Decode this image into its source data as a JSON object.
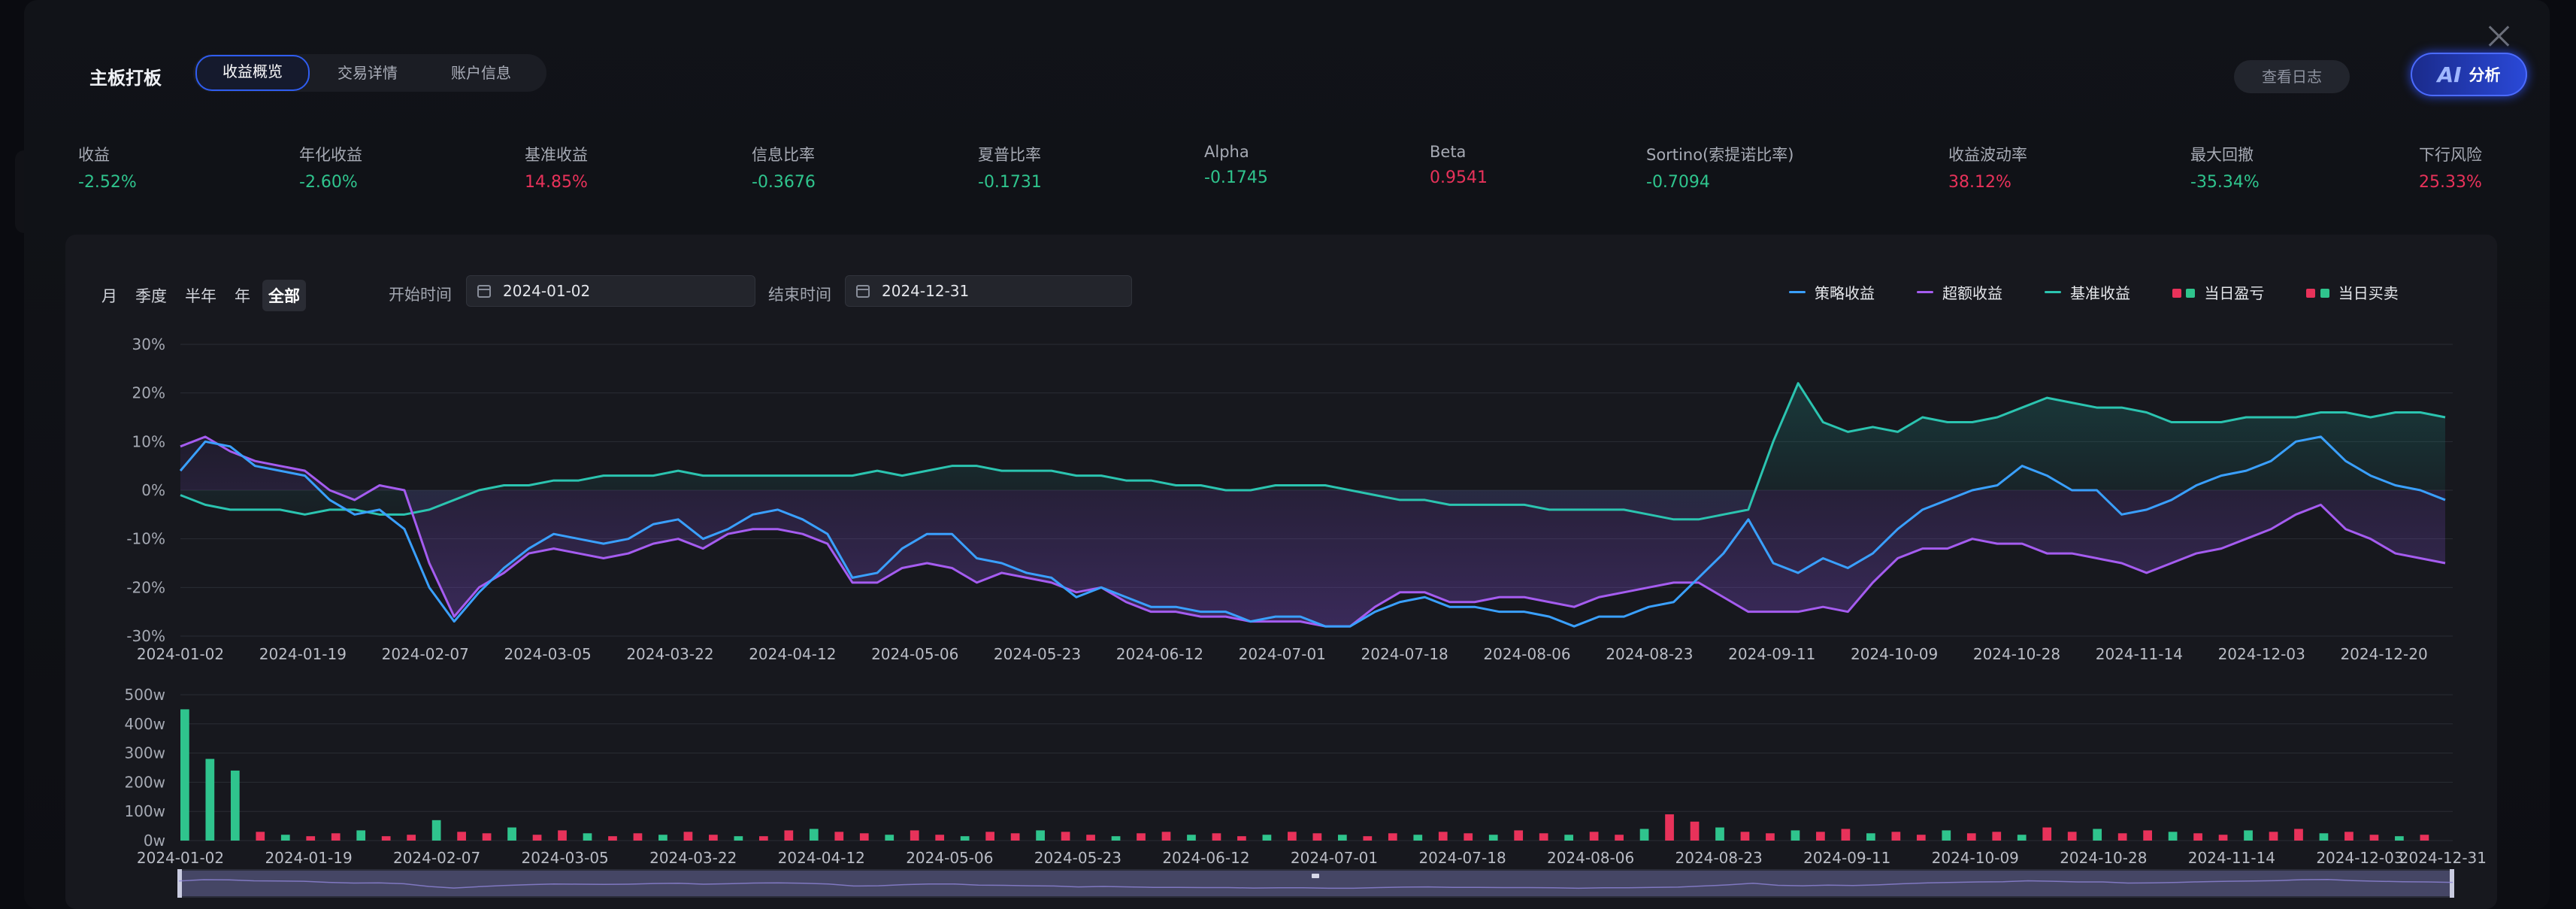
{
  "header": {
    "title": "主板打板",
    "tabs": [
      {
        "label": "收益概览",
        "active": true
      },
      {
        "label": "交易详情",
        "active": false
      },
      {
        "label": "账户信息",
        "active": false
      }
    ],
    "log_button": "查看日志",
    "ai_button": {
      "icon": "AI",
      "label": "分析"
    }
  },
  "metrics": [
    {
      "label": "收益",
      "value": "-2.52%",
      "tone": "neg"
    },
    {
      "label": "年化收益",
      "value": "-2.60%",
      "tone": "neg"
    },
    {
      "label": "基准收益",
      "value": "14.85%",
      "tone": "pos"
    },
    {
      "label": "信息比率",
      "value": "-0.3676",
      "tone": "neg"
    },
    {
      "label": "夏普比率",
      "value": "-0.1731",
      "tone": "neg"
    },
    {
      "label": "Alpha",
      "value": "-0.1745",
      "tone": "neg"
    },
    {
      "label": "Beta",
      "value": "0.9541",
      "tone": "pos"
    },
    {
      "label": "Sortino(索提诺比率)",
      "value": "-0.7094",
      "tone": "neg"
    },
    {
      "label": "收益波动率",
      "value": "38.12%",
      "tone": "pos"
    },
    {
      "label": "最大回撤",
      "value": "-35.34%",
      "tone": "neg"
    },
    {
      "label": "下行风险",
      "value": "25.33%",
      "tone": "pos"
    }
  ],
  "filters": {
    "periods": [
      {
        "label": "月",
        "active": false
      },
      {
        "label": "季度",
        "active": false
      },
      {
        "label": "半年",
        "active": false
      },
      {
        "label": "年",
        "active": false
      },
      {
        "label": "全部",
        "active": true
      }
    ],
    "start_label": "开始时间",
    "start_date": "2024-01-02",
    "end_label": "结束时间",
    "end_date": "2024-12-31"
  },
  "legend": [
    {
      "label": "策略收益",
      "kind": "line",
      "color": "#3aa0ff"
    },
    {
      "label": "超额收益",
      "kind": "line",
      "color": "#a55cf0"
    },
    {
      "label": "基准收益",
      "kind": "line",
      "color": "#2bc4b0"
    },
    {
      "label": "当日盈亏",
      "kind": "squares",
      "colors": [
        "#e8325a",
        "#2fc48d"
      ]
    },
    {
      "label": "当日买卖",
      "kind": "squares",
      "colors": [
        "#e8325a",
        "#2fc48d"
      ]
    }
  ],
  "colors": {
    "positive": "#e8325a",
    "negative": "#2fc48d",
    "strategy": "#3aa0ff",
    "excess": "#a55cf0",
    "benchmark": "#2bc4b0"
  },
  "chart_data": [
    {
      "type": "line",
      "x_ticks": [
        "2024-01-02",
        "2024-01-19",
        "2024-02-07",
        "2024-03-05",
        "2024-03-22",
        "2024-04-12",
        "2024-05-06",
        "2024-05-23",
        "2024-06-12",
        "2024-07-01",
        "2024-07-18",
        "2024-08-06",
        "2024-08-23",
        "2024-09-11",
        "2024-10-09",
        "2024-10-28",
        "2024-11-14",
        "2024-12-03",
        "2024-12-20"
      ],
      "y_ticks": [
        "30%",
        "20%",
        "10%",
        "0%",
        "-10%",
        "-20%",
        "-30%"
      ],
      "ylim": [
        -30,
        30
      ],
      "grid": true,
      "series": [
        {
          "name": "策略收益",
          "values": [
            4,
            10,
            9,
            5,
            4,
            3,
            -2,
            -5,
            -4,
            -8,
            -20,
            -27,
            -21,
            -16,
            -12,
            -9,
            -10,
            -11,
            -10,
            -7,
            -6,
            -10,
            -8,
            -5,
            -4,
            -6,
            -9,
            -18,
            -17,
            -12,
            -9,
            -9,
            -14,
            -15,
            -17,
            -18,
            -22,
            -20,
            -22,
            -24,
            -24,
            -25,
            -25,
            -27,
            -26,
            -26,
            -28,
            -28,
            -25,
            -23,
            -22,
            -24,
            -24,
            -25,
            -25,
            -26,
            -28,
            -26,
            -26,
            -24,
            -23,
            -18,
            -13,
            -6,
            -15,
            -17,
            -14,
            -16,
            -13,
            -8,
            -4,
            -2,
            0,
            1,
            5,
            3,
            0,
            0,
            -5,
            -4,
            -2,
            1,
            3,
            4,
            6,
            10,
            11,
            6,
            3,
            1,
            0,
            -2
          ]
        },
        {
          "name": "超额收益",
          "values": [
            9,
            11,
            8,
            6,
            5,
            4,
            0,
            -2,
            1,
            0,
            -15,
            -26,
            -20,
            -17,
            -13,
            -12,
            -13,
            -14,
            -13,
            -11,
            -10,
            -12,
            -9,
            -8,
            -8,
            -9,
            -11,
            -19,
            -19,
            -16,
            -15,
            -16,
            -19,
            -17,
            -18,
            -19,
            -21,
            -20,
            -23,
            -25,
            -25,
            -26,
            -26,
            -27,
            -27,
            -27,
            -28,
            -28,
            -24,
            -21,
            -21,
            -23,
            -23,
            -22,
            -22,
            -23,
            -24,
            -22,
            -21,
            -20,
            -19,
            -19,
            -22,
            -25,
            -25,
            -25,
            -24,
            -25,
            -19,
            -14,
            -12,
            -12,
            -10,
            -11,
            -11,
            -13,
            -13,
            -14,
            -15,
            -17,
            -15,
            -13,
            -12,
            -10,
            -8,
            -5,
            -3,
            -8,
            -10,
            -13,
            -14,
            -15
          ]
        },
        {
          "name": "基准收益",
          "values": [
            -1,
            -3,
            -4,
            -4,
            -4,
            -5,
            -4,
            -4,
            -5,
            -5,
            -4,
            -2,
            0,
            1,
            1,
            2,
            2,
            3,
            3,
            3,
            4,
            3,
            3,
            3,
            3,
            3,
            3,
            3,
            4,
            3,
            4,
            5,
            5,
            4,
            4,
            4,
            3,
            3,
            2,
            2,
            1,
            1,
            0,
            0,
            1,
            1,
            1,
            0,
            -1,
            -2,
            -2,
            -3,
            -3,
            -3,
            -3,
            -4,
            -4,
            -4,
            -4,
            -5,
            -6,
            -6,
            -5,
            -4,
            10,
            22,
            14,
            12,
            13,
            12,
            15,
            14,
            14,
            15,
            17,
            19,
            18,
            17,
            17,
            16,
            14,
            14,
            14,
            15,
            15,
            15,
            16,
            16,
            15,
            16,
            16,
            15
          ]
        }
      ]
    },
    {
      "type": "bar",
      "y_ticks": [
        "500w",
        "400w",
        "300w",
        "200w",
        "100w",
        "0w"
      ],
      "ylim": [
        0,
        500
      ],
      "x_ticks": [
        "2024-01-02",
        "2024-01-19",
        "2024-02-07",
        "2024-03-05",
        "2024-03-22",
        "2024-04-12",
        "2024-05-06",
        "2024-05-23",
        "2024-06-12",
        "2024-07-01",
        "2024-07-18",
        "2024-08-06",
        "2024-08-23",
        "2024-09-11",
        "2024-10-09",
        "2024-10-28",
        "2024-11-14",
        "2024-12-03",
        "2024-12-31"
      ],
      "series": [
        {
          "name": "当日买卖",
          "values": [
            450,
            280,
            240,
            30,
            20,
            15,
            25,
            35,
            15,
            20,
            70,
            30,
            25,
            45,
            20,
            35,
            25,
            15,
            25,
            20,
            30,
            20,
            15,
            15,
            35,
            40,
            30,
            25,
            20,
            35,
            20,
            15,
            30,
            25,
            35,
            30,
            20,
            15,
            25,
            30,
            20,
            25,
            15,
            20,
            30,
            25,
            20,
            15,
            25,
            20,
            30,
            25,
            20,
            35,
            25,
            20,
            30,
            20,
            40,
            90,
            65,
            45,
            30,
            25,
            35,
            30,
            40,
            25,
            30,
            20,
            35,
            25,
            30,
            20,
            45,
            30,
            40,
            25,
            35,
            30,
            25,
            20,
            35,
            30,
            40,
            25,
            30,
            20,
            15,
            20
          ]
        }
      ]
    }
  ]
}
